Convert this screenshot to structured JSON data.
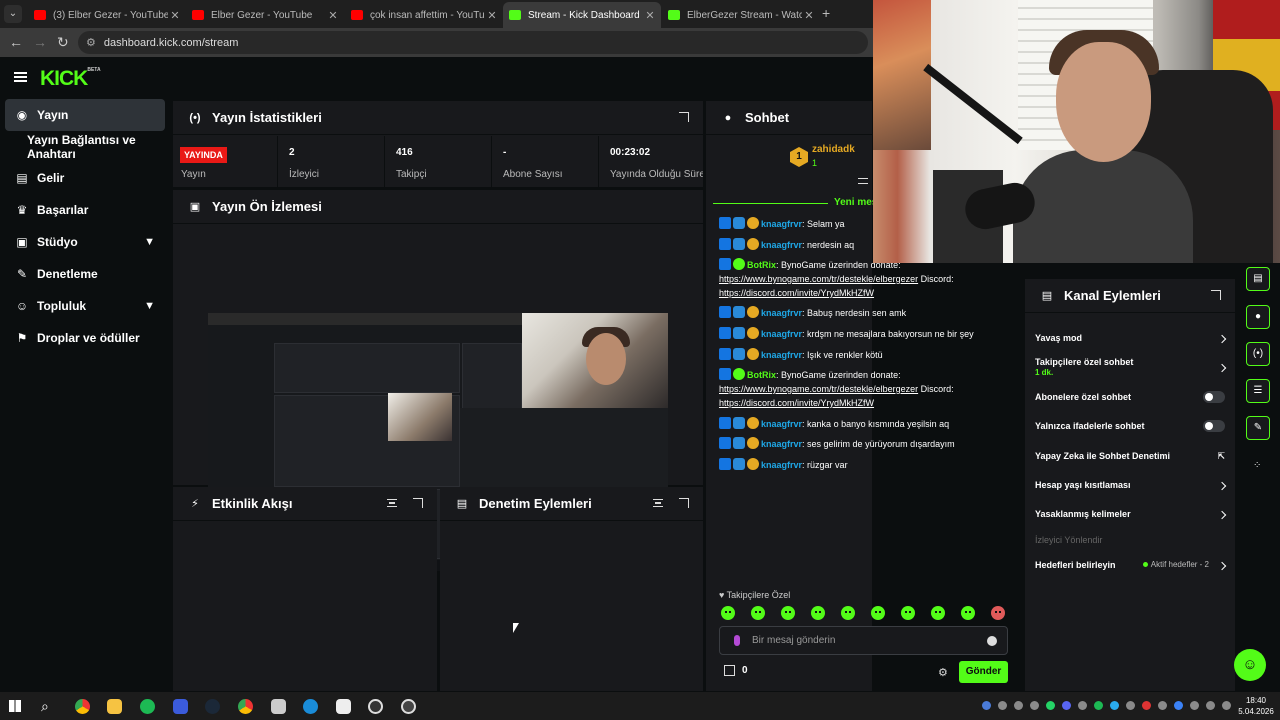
{
  "browser": {
    "tabs": [
      {
        "label": "(3) Elber Gezer - YouTube",
        "icon": "youtube-icon",
        "active": false
      },
      {
        "label": "Elber Gezer - YouTube",
        "icon": "youtube-icon",
        "active": false
      },
      {
        "label": "çok insan affettim - YouTube",
        "icon": "youtube-icon",
        "active": false
      },
      {
        "label": "Stream - Kick Dashboard",
        "icon": "kick-icon",
        "active": true
      },
      {
        "label": "ElberGezer Stream - Watch Live",
        "icon": "kick-icon",
        "active": false
      }
    ],
    "new_tab": "+",
    "close": "✕",
    "back": "←",
    "forward": "→",
    "reload": "↻",
    "url": "dashboard.kick.com/stream"
  },
  "brand": {
    "logo": "KICK",
    "beta": "BETA",
    "accent": "#53fc18"
  },
  "sidebar": {
    "items": [
      {
        "label": "Yayın",
        "icon": "broadcast-icon",
        "active": true,
        "chevron": false
      },
      {
        "label": "Yayın Bağlantısı ve Anahtarı",
        "icon": "",
        "active": false,
        "chevron": false
      },
      {
        "label": "Gelir",
        "icon": "revenue-icon",
        "active": false,
        "chevron": false
      },
      {
        "label": "Başarılar",
        "icon": "trophy-icon",
        "active": false,
        "chevron": false
      },
      {
        "label": "Stüdyo",
        "icon": "studio-icon",
        "active": false,
        "chevron": true
      },
      {
        "label": "Denetleme",
        "icon": "wrench-icon",
        "active": false,
        "chevron": false
      },
      {
        "label": "Topluluk",
        "icon": "community-icon",
        "active": false,
        "chevron": true
      },
      {
        "label": "Droplar ve ödüller",
        "icon": "gift-icon",
        "active": false,
        "chevron": false
      }
    ]
  },
  "stats": {
    "title": "Yayın İstatistikleri",
    "live_badge": "YAYINDA",
    "items": [
      {
        "value": "",
        "label": "Yayın"
      },
      {
        "value": "2",
        "label": "İzleyici"
      },
      {
        "value": "416",
        "label": "Takipçi"
      },
      {
        "value": "-",
        "label": "Abone Sayısı"
      },
      {
        "value": "00:23:02",
        "label": "Yayında Olduğu Süre"
      }
    ]
  },
  "preview": {
    "title": "Yayın Ön İzlemesi"
  },
  "activity": {
    "title": "Etkinlik Akışı"
  },
  "moderation": {
    "title": "Denetim Eylemleri"
  },
  "chat": {
    "title": "Sohbet",
    "pinned": {
      "username": "zahidadk",
      "badge": "1",
      "sub": "1"
    },
    "new_messages": "Yeni mes",
    "messages": [
      {
        "user": "knaagfrvr",
        "bot": false,
        "text": "Selam ya"
      },
      {
        "user": "knaagfrvr",
        "bot": false,
        "text": "nerdesin aq"
      },
      {
        "user": "BotRix",
        "bot": true,
        "text": "BynoGame üzerinden donate: ",
        "link1": "https://www.bynogame.com/tr/destekle/elbergezer",
        "mid": " Discord: ",
        "link2": "https://discord.com/invite/YrydMkHZfW"
      },
      {
        "user": "knaagfrvr",
        "bot": false,
        "text": "Babuş nerdesin sen amk"
      },
      {
        "user": "knaagfrvr",
        "bot": false,
        "text": "krdşm ne mesajlara bakıyorsun ne bir şey"
      },
      {
        "user": "knaagfrvr",
        "bot": false,
        "text": "Işık ve renkler kötü"
      },
      {
        "user": "BotRix",
        "bot": true,
        "text": "BynoGame üzerinden donate: ",
        "link1": "https://www.bynogame.com/tr/destekle/elbergezer",
        "mid": " Discord: ",
        "link2": "https://discord.com/invite/YrydMkHZfW"
      },
      {
        "user": "knaagfrvr",
        "bot": false,
        "text": "kanka o banyo kısmında yeşilsin aq"
      },
      {
        "user": "knaagfrvr",
        "bot": false,
        "text": "ses gelirim de yürüyorum dışardayım"
      },
      {
        "user": "knaagfrvr",
        "bot": false,
        "text": "rüzgar var"
      }
    ],
    "followers_label": "♥ Takipçilere Özel",
    "input_placeholder": "Bir mesaj gönderin",
    "points": "0",
    "send_label": "Gönder"
  },
  "channel_actions": {
    "title": "Kanal Eylemleri",
    "items": [
      {
        "label": "Yavaş mod",
        "type": "arrow",
        "sub": ""
      },
      {
        "label": "Takipçilere özel sohbet",
        "type": "arrow",
        "sub": "1 dk."
      },
      {
        "label": "Abonelere özel sohbet",
        "type": "toggle",
        "sub": ""
      },
      {
        "label": "Yalnızca ifadelerle sohbet",
        "type": "toggle",
        "sub": ""
      },
      {
        "label": "Yapay Zeka ile Sohbet Denetimi",
        "type": "external",
        "sub": ""
      },
      {
        "label": "Hesap yaşı kısıtlaması",
        "type": "arrow",
        "sub": ""
      },
      {
        "label": "Yasaklanmış kelimeler",
        "type": "arrow",
        "sub": ""
      },
      {
        "label": "İzleyici Yönlendir",
        "type": "disabled",
        "sub": ""
      },
      {
        "label": "Hedefleri belirleyin",
        "type": "arrow",
        "sub": "",
        "badge": "Aktif hedefler - 2"
      }
    ]
  },
  "taskbar": {
    "time": "18:40",
    "date": "5.04.2026"
  }
}
